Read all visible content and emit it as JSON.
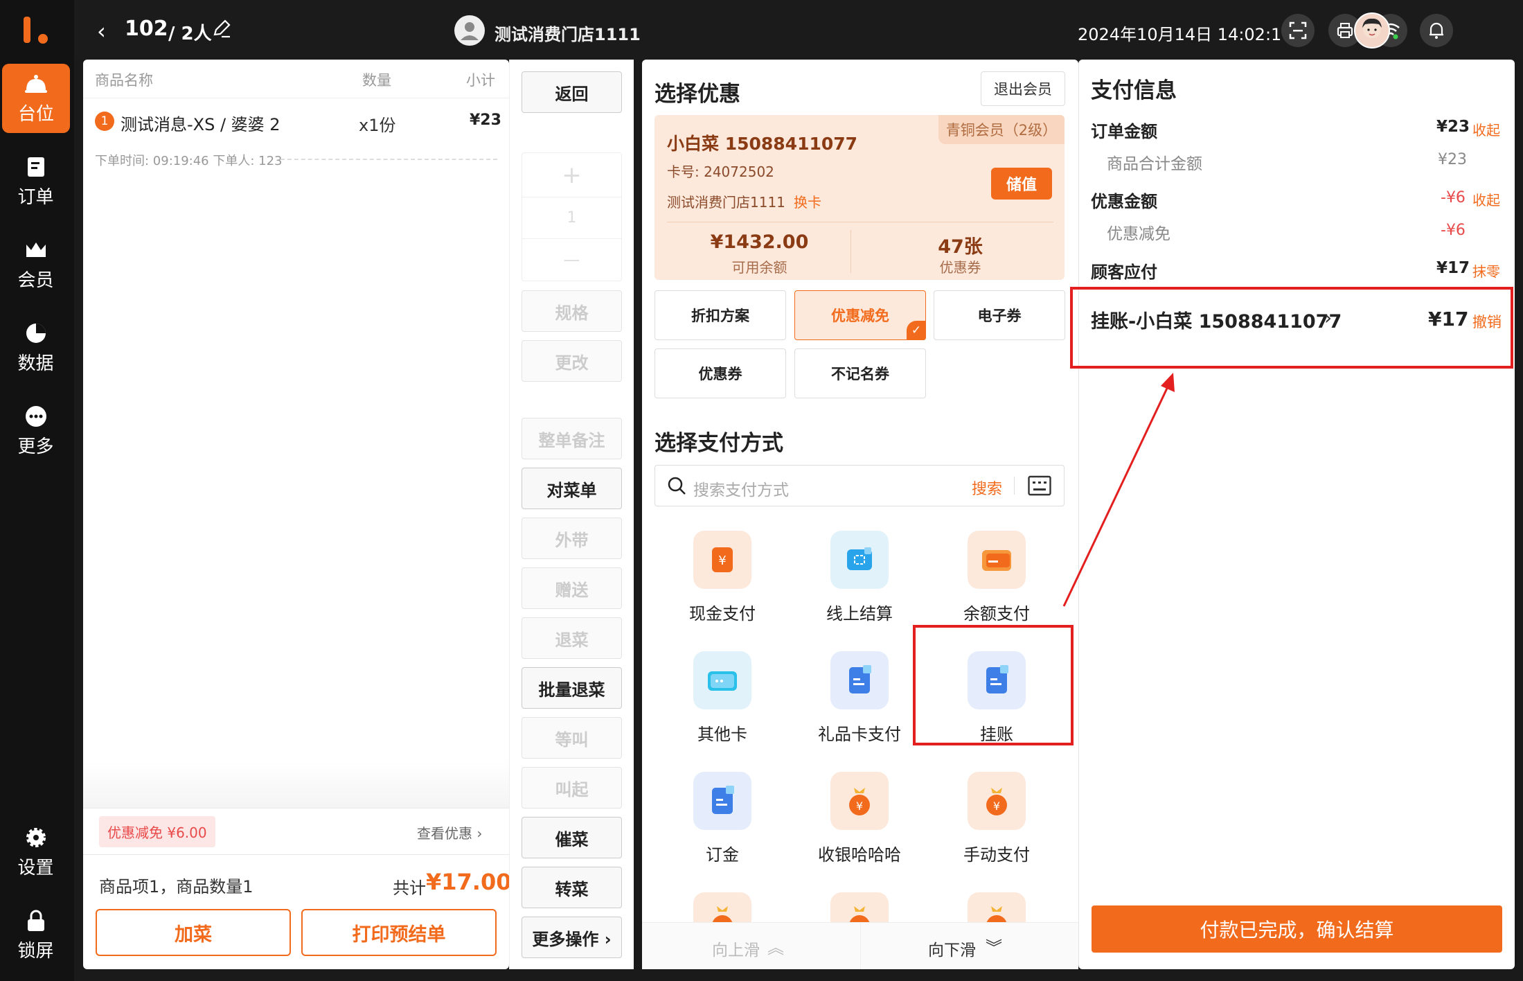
{
  "header": {
    "table_no": "102",
    "people": "/ 2人",
    "store_name": "测试消费门店1111",
    "datetime": "2024年10月14日 14:02:16"
  },
  "sidebar": {
    "items": [
      {
        "label": "台位",
        "icon": "bell-icon",
        "active": true
      },
      {
        "label": "订单",
        "icon": "order-icon"
      },
      {
        "label": "会员",
        "icon": "crown-icon"
      },
      {
        "label": "数据",
        "icon": "pie-chart-icon"
      },
      {
        "label": "更多",
        "icon": "more-icon"
      },
      {
        "label": "设置",
        "icon": "gear-icon"
      },
      {
        "label": "锁屏",
        "icon": "lock-icon"
      }
    ]
  },
  "order": {
    "col_name": "商品名称",
    "col_qty": "数量",
    "col_sub": "小计",
    "item": {
      "index": "1",
      "name": "测试消息-XS / 婆婆 2",
      "qty": "x1份",
      "subtotal": "¥23"
    },
    "meta": "下单时间: 09:19:46    下单人: 123",
    "discount_tag": "优惠减免 ¥6.00",
    "view_promo": "查看优惠 ›",
    "summary": "商品项1，商品数量1",
    "total_label": "共计",
    "total_value": "¥17.00",
    "add_dish": "加菜",
    "print_pre": "打印预结单"
  },
  "ops": {
    "back": "返回",
    "plus": "+",
    "count": "1",
    "minus": "—",
    "spec": "规格",
    "modify": "更改",
    "note": "整单备注",
    "check": "对菜单",
    "takeout": "外带",
    "gift": "赠送",
    "return": "退菜",
    "batch_return": "批量退菜",
    "wait": "等叫",
    "call": "叫起",
    "rush": "催菜",
    "transfer": "转菜",
    "more": "更多操作 ›"
  },
  "promo": {
    "title": "选择优惠",
    "exit_member": "退出会员",
    "member_level": "青铜会员（2级）",
    "member_name": "小白菜  15088411077",
    "card_no": "卡号:  24072502",
    "member_store": "测试消费门店1111",
    "change_card": "换卡",
    "charge": "储值",
    "balance_value": "¥1432.00",
    "balance_label": "可用余额",
    "coupon_value": "47张",
    "coupon_label": "优惠券",
    "tabs": [
      "折扣方案",
      "优惠减免",
      "电子券",
      "优惠券",
      "不记名券"
    ],
    "selected_tab": "优惠减免"
  },
  "payment": {
    "title": "选择支付方式",
    "search_placeholder": "搜索支付方式",
    "search_label": "搜索",
    "methods": [
      {
        "label": "现金支付",
        "icon": "cash-icon"
      },
      {
        "label": "线上结算",
        "icon": "online-icon"
      },
      {
        "label": "余额支付",
        "icon": "wallet-icon"
      },
      {
        "label": "其他卡",
        "icon": "card-icon"
      },
      {
        "label": "礼品卡支付",
        "icon": "gift-card-icon"
      },
      {
        "label": "挂账",
        "icon": "credit-icon"
      },
      {
        "label": "订金",
        "icon": "deposit-icon"
      },
      {
        "label": "收银哈哈哈",
        "icon": "moneybag-icon"
      },
      {
        "label": "手动支付",
        "icon": "moneybag-icon"
      }
    ],
    "scroll_up": "向上滑",
    "scroll_down": "向下滑"
  },
  "pay_info": {
    "title": "支付信息",
    "order_amount_label": "订单金额",
    "order_amount": "¥23",
    "collapse1": "收起",
    "goods_total_label": "商品合计金额",
    "goods_total": "¥23",
    "discount_label": "优惠金额",
    "discount": "-¥6",
    "collapse2": "收起",
    "discount_sub_label": "优惠减免",
    "discount_sub": "-¥6",
    "due_label": "顾客应付",
    "due": "¥17",
    "round_off": "抹零",
    "credit_line": "挂账-小白菜 15088411077",
    "credit_amount": "¥17",
    "undo": "撤销",
    "confirm": "付款已完成，确认结算"
  },
  "colors": {
    "accent": "#f26b1d",
    "highlight": "#e31f1f"
  }
}
